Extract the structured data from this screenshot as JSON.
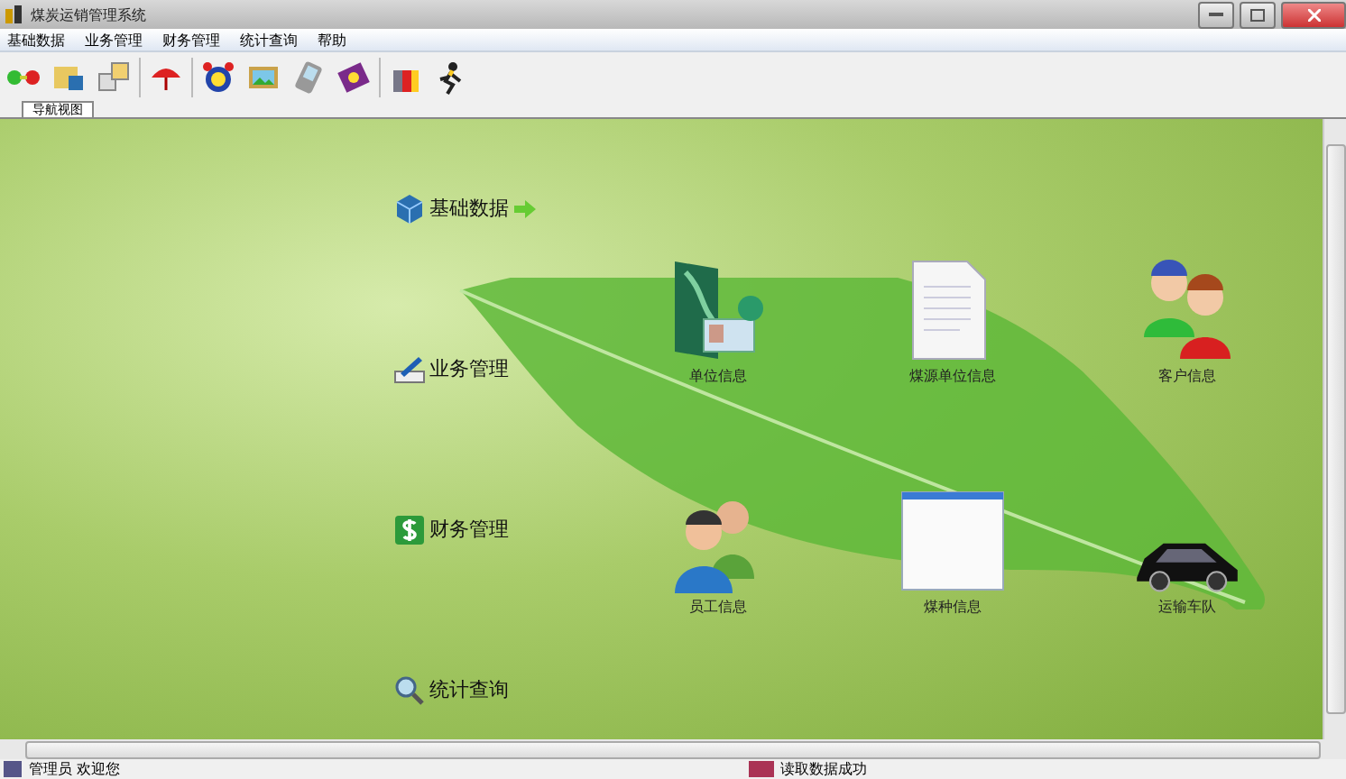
{
  "window": {
    "title": "煤炭运销管理系统"
  },
  "menu": [
    "基础数据",
    "业务管理",
    "财务管理",
    "统计查询",
    "帮助"
  ],
  "toolbar": [
    {
      "kind": "link"
    },
    {
      "kind": "folder"
    },
    {
      "kind": "copy"
    },
    {
      "kind": "umbrella"
    },
    {
      "kind": "clock"
    },
    {
      "kind": "picture"
    },
    {
      "kind": "pda"
    },
    {
      "kind": "book"
    },
    {
      "kind": "gift"
    },
    {
      "kind": "runner"
    }
  ],
  "view_tabs": [
    {
      "label": "导航视图",
      "selected": true
    }
  ],
  "nav": [
    {
      "label": "基础数据",
      "kind": "cube",
      "selected": true
    },
    {
      "label": "业务管理",
      "kind": "pen",
      "selected": false
    },
    {
      "label": "财务管理",
      "kind": "money",
      "selected": false
    },
    {
      "label": "统计查询",
      "kind": "search",
      "selected": false
    }
  ],
  "modules": [
    {
      "label": "单位信息",
      "kind": "card"
    },
    {
      "label": "煤源单位信息",
      "kind": "document"
    },
    {
      "label": "客户信息",
      "kind": "users"
    },
    {
      "label": "员工信息",
      "kind": "people"
    },
    {
      "label": "煤种信息",
      "kind": "window"
    },
    {
      "label": "运输车队",
      "kind": "car"
    }
  ],
  "status_bar": {
    "user": "管理员 欢迎您",
    "message": "读取数据成功"
  }
}
